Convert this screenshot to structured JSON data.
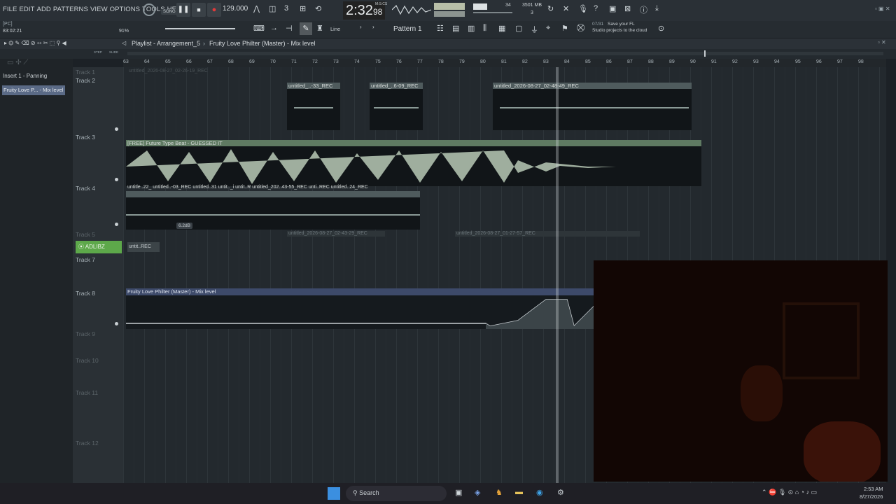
{
  "menu": [
    "FILE",
    "EDIT",
    "ADD",
    "PATTERNS",
    "VIEW",
    "OPTIONS",
    "TOOLS",
    "HELP"
  ],
  "transport": {
    "song_label": "SONG",
    "tempo": "129.000",
    "time": "2:32",
    "time_sub": "98",
    "time_unit": "M:S:CS",
    "cpu": "34",
    "mem": "3501 MB",
    "poly": "3"
  },
  "hint": {
    "pc": "[PC]",
    "pos": "83:02:21",
    "zoom": "91%"
  },
  "snap_label": "Line",
  "pattern_label": "Pattern 1",
  "news": {
    "count": "07/31",
    "line1": "Save your FL",
    "line2": "Studio projects to the cloud"
  },
  "playlist": {
    "breadcrumb": "Playlist - Arrangement_5",
    "target": "Fruity Love Philter (Master) - Mix level",
    "step_label": "STEP",
    "slide_label": "SLIDE"
  },
  "left_panel": {
    "items": [
      "Insert 1 - Panning",
      "Fruity Love P... - Mix level"
    ]
  },
  "ruler": [
    "63",
    "64",
    "65",
    "66",
    "67",
    "68",
    "69",
    "70",
    "71",
    "72",
    "73",
    "74",
    "75",
    "76",
    "77",
    "78",
    "79",
    "80",
    "81",
    "82",
    "83",
    "84",
    "85",
    "86",
    "87",
    "88",
    "89",
    "90",
    "91",
    "92",
    "93",
    "94",
    "95",
    "96",
    "97",
    "98"
  ],
  "tracks": [
    "Track 1",
    "Track 2",
    "Track 3",
    "Track 4",
    "Track 5",
    "ADLIBZ",
    "Track 7",
    "Track 8",
    "Track 9",
    "Track 10",
    "Track 11",
    "Track 12"
  ],
  "clips": {
    "t1": "untitled_2026-08-27_02-26-19_REC",
    "t2a": "untitled_..-33_REC",
    "t2b": "untitled_..6-09_REC",
    "t2c": "untitled_2026-08-27_02-48-49_REC",
    "t3": "[FREE] Future Type Beat - GUESSED IT",
    "t4": [
      "untitle..22_",
      "untitled..-03_REC",
      "untitled..31",
      "untit.._i",
      "untit..R",
      "untitled_202..43-55_REC",
      "unti..REC",
      "untitled..24_REC"
    ],
    "t4_vol": "6.2dB",
    "t5a": "untitled_2026-08-27_02-43-29_REC",
    "t5b": "untitled_2026-08-27_01-27-57_REC",
    "t6": "untit..REC",
    "t8": "Fruity Love Philter (Master) - Mix level"
  },
  "taskbar": {
    "search": "Search",
    "time": "2:53 AM",
    "date": "8/27/2026"
  },
  "colors": {
    "accent_green": "#5da84a",
    "clip_header": "#4f5b5d",
    "auto_header": "#3d4a6a"
  }
}
